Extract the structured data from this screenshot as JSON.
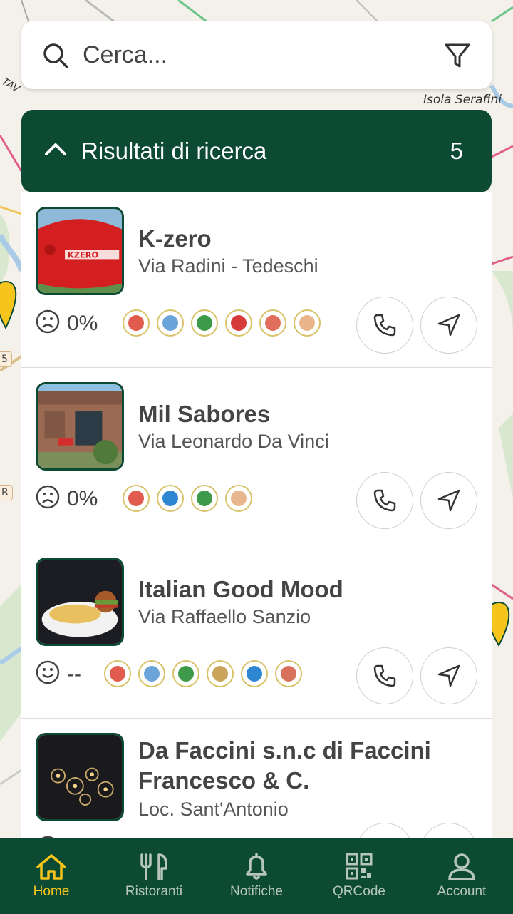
{
  "map": {
    "labels": [
      "Isola Serafini",
      "TAV"
    ],
    "edge_labels": [
      "5",
      "R"
    ]
  },
  "search": {
    "placeholder": "Cerca...",
    "icon": "search-icon",
    "filter_icon": "filter-icon"
  },
  "results": {
    "title": "Risultati di ricerca",
    "count": "5",
    "items": [
      {
        "name": "K-zero",
        "address": "Via Radini - Tedeschi",
        "rating_icon": "sad-face-icon",
        "rating": "0%",
        "badges": [
          "#e25b4f",
          "#6aa4d8",
          "#3c9a4a",
          "#d63a3a",
          "#e0705d",
          "#e8b58c"
        ]
      },
      {
        "name": "Mil Sabores",
        "address": "Via Leonardo Da Vinci",
        "rating_icon": "sad-face-icon",
        "rating": "0%",
        "badges": [
          "#e25b4f",
          "#2f86d1",
          "#3c9a4a",
          "#e8b58c"
        ]
      },
      {
        "name": "Italian Good Mood",
        "address": "Via Raffaello Sanzio",
        "rating_icon": "smile-face-icon",
        "rating": "--",
        "badges": [
          "#e25b4f",
          "#6aa4d8",
          "#3c9a4a",
          "#c9a45a",
          "#2f86d1",
          "#d8725d"
        ]
      },
      {
        "name": "Da Faccini s.n.c di Faccini Francesco & C.",
        "address": "Loc. Sant'Antonio",
        "rating_icon": "sad-face-icon",
        "rating": "",
        "badges": []
      }
    ]
  },
  "nav": {
    "items": [
      {
        "label": "Home",
        "icon": "home-icon",
        "active": true
      },
      {
        "label": "Ristoranti",
        "icon": "restaurant-icon",
        "active": false
      },
      {
        "label": "Notifiche",
        "icon": "bell-icon",
        "active": false
      },
      {
        "label": "QRCode",
        "icon": "qrcode-icon",
        "active": false
      },
      {
        "label": "Account",
        "icon": "account-icon",
        "active": false
      }
    ]
  },
  "colors": {
    "brand": "#0d4a34",
    "active_nav": "#f5c51c",
    "inactive_nav": "#b6c6bc"
  }
}
